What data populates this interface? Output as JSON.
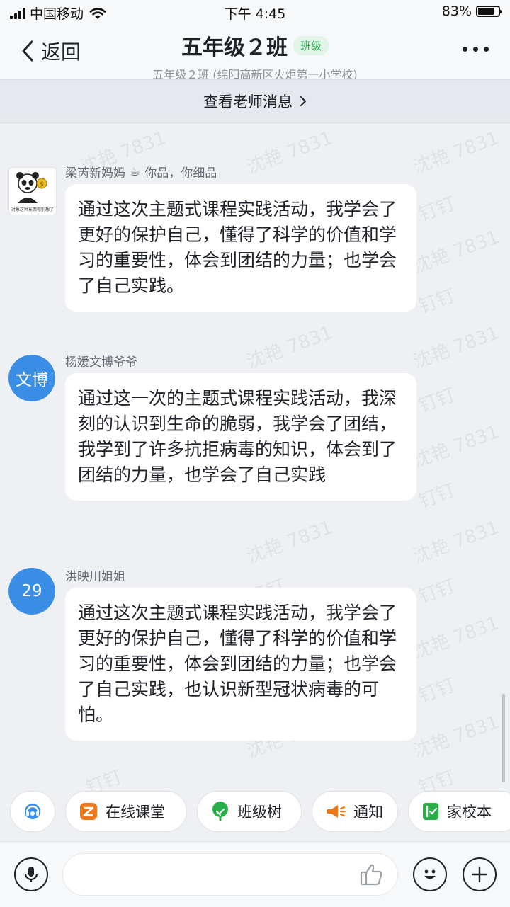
{
  "status_bar": {
    "carrier": "中国移动",
    "time": "下午 4:45",
    "battery_text": "83%",
    "battery_level": 0.83
  },
  "header": {
    "back_label": "返回",
    "title": "五年级２班",
    "badge": "班级",
    "subtitle": "五年级２班 (绵阳高新区火炬第一小学校)"
  },
  "teacher_bar": {
    "label": "查看老师消息"
  },
  "watermark": {
    "name": "沈艳 7831",
    "app": "钉钉"
  },
  "messages": [
    {
      "sender": "梁芮新妈妈",
      "signature": "你品，你细品",
      "avatar_caption": "对象这种东西你别想了",
      "text": "通过这次主题式课程实践活动，我学会了更好的保护自己，懂得了科学的价值和学习的重要性，体会到团结的力量；也学会了自己实践。"
    },
    {
      "sender": "杨媛文博爷爷",
      "avatar_text": "文博",
      "text": "通过这一次的主题式课程实践活动，我深刻的认识到生命的脆弱，我学会了团结，我学到了许多抗拒病毒的知识，体会到了团结的力量，也学会了自己实践"
    },
    {
      "sender": "洪映川姐姐",
      "avatar_text": "29",
      "text": "通过这次主题式课程实践活动，我学会了更好的保护自己，懂得了科学的价值和学习的重要性，体会到团结的力量；也学会了自己实践，也认识新型冠状病毒的可怕。"
    }
  ],
  "quick_bar": {
    "items": [
      "在线课堂",
      "班级树",
      "通知",
      "家校本"
    ]
  },
  "colors": {
    "accent_blue": "#3a8ee6",
    "badge_green": "#2fa84f",
    "orange": "#f0761a",
    "green": "#2aae4a"
  }
}
